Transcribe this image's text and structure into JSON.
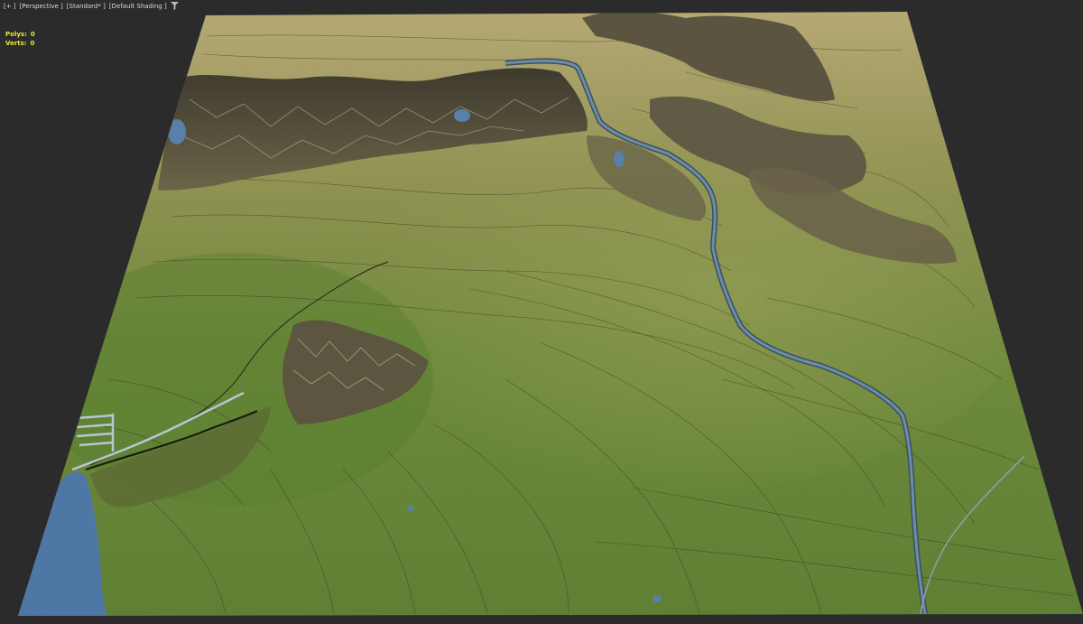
{
  "viewport": {
    "menu_plus": "[+ ]",
    "view_mode": "[Perspective ]",
    "render_mode": "[Standard* ]",
    "shading_mode": "[Default Shading ]"
  },
  "stats": {
    "polys_label": "Polys:",
    "polys_value": "0",
    "verts_label": "Verts:",
    "verts_value": "0"
  },
  "colors": {
    "background": "#2b2b2b",
    "stats_text": "#e8e83a",
    "terrain_low": "#5c7a33",
    "terrain_high": "#b5a874",
    "water": "#5a7fa8",
    "mountain": "#4a4536"
  },
  "icons": {
    "filter": "filter-icon"
  }
}
